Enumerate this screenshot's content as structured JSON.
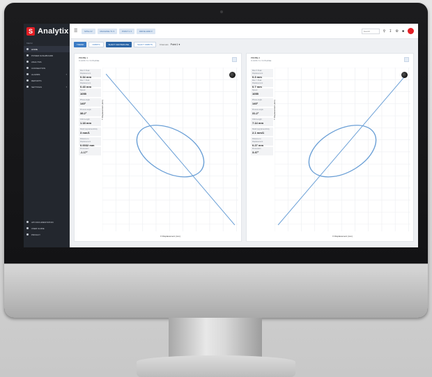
{
  "app": {
    "name": "Analytix",
    "logo_letter": "S"
  },
  "sidebar": {
    "menu_label": "MENU",
    "items": [
      {
        "label": "HOME",
        "active": true,
        "has_caret": false
      },
      {
        "label": "POWER DASHBOARD",
        "active": false,
        "has_caret": false
      },
      {
        "label": "ANALYSIS",
        "active": false,
        "has_caret": false
      },
      {
        "label": "CONNECTION",
        "active": false,
        "has_caret": false
      },
      {
        "label": "ALARMS",
        "active": false,
        "has_caret": true
      },
      {
        "label": "REPORTS",
        "active": false,
        "has_caret": false
      },
      {
        "label": "SETTINGS",
        "active": false,
        "has_caret": true
      }
    ],
    "bottom_items": [
      {
        "label": "API DOCUMENTATION"
      },
      {
        "label": "USER GUIDE"
      },
      {
        "label": "PRIVACY"
      }
    ]
  },
  "topbar": {
    "filters": [
      "SITE A ▾",
      "MACHINE T1 ▾",
      "POINT 1 ▾",
      "DRIVE END ▾"
    ],
    "search_placeholder": "Search"
  },
  "toolbar": {
    "buttons": [
      "TREND",
      "ORBITS",
      "SHAFT CENTERLINE",
      "SHAFT ORBITS"
    ],
    "label": "Channels",
    "select_value": "Point 1 ▾"
  },
  "panels": [
    {
      "title": "PROBE 1",
      "subtitle": "X AXIS Y1 Y2 PHASE",
      "stats": [
        {
          "label": "Max X Peak Displacement",
          "value": "0.34 mm"
        },
        {
          "label": "Max Y Peak Displacement",
          "value": "0.43 mm"
        },
        {
          "label": "Speed",
          "value": "1055"
        },
        {
          "label": "Phase angle",
          "value": "140°"
        },
        {
          "label": "Precess angle",
          "value": "38.2°"
        },
        {
          "label": "Orbit Length",
          "value": "1.18 mm"
        },
        {
          "label": "Shaft Gap Eccentricity",
          "value": "3 mm/1"
        },
        {
          "label": "Distance to Displacement",
          "value": "0.0032 mm"
        },
        {
          "label": "Precession",
          "value": "-1.17°"
        }
      ],
      "x_axis_label": "X Displacement (mm)",
      "y_axis_label": "Y Displacement (mm)"
    },
    {
      "title": "PROBE 2",
      "subtitle": "X AXIS Y1 Y2 PHASE",
      "stats": [
        {
          "label": "Max X Peak Displacement",
          "value": "0.3 mm"
        },
        {
          "label": "Max Y Peak Displacement",
          "value": "0.7 mm"
        },
        {
          "label": "Speed",
          "value": "1055"
        },
        {
          "label": "Phase angle",
          "value": "140°"
        },
        {
          "label": "Precess angle",
          "value": "31.2°"
        },
        {
          "label": "Orbit Length",
          "value": "7.14 mm"
        },
        {
          "label": "Shaft Gap Eccentricity",
          "value": "2.1 mm/1"
        },
        {
          "label": "Distance to Displacement",
          "value": "0.27 mm"
        },
        {
          "label": "Precession",
          "value": "3.47°"
        }
      ],
      "x_axis_label": "X Displacement (mm)",
      "y_axis_label": "Y Displacement (mm)"
    }
  ],
  "colors": {
    "accent": "#3b7bc4",
    "brand": "#e31e24",
    "sidebar": "#23272e",
    "orbit": "#6a9fd6"
  }
}
